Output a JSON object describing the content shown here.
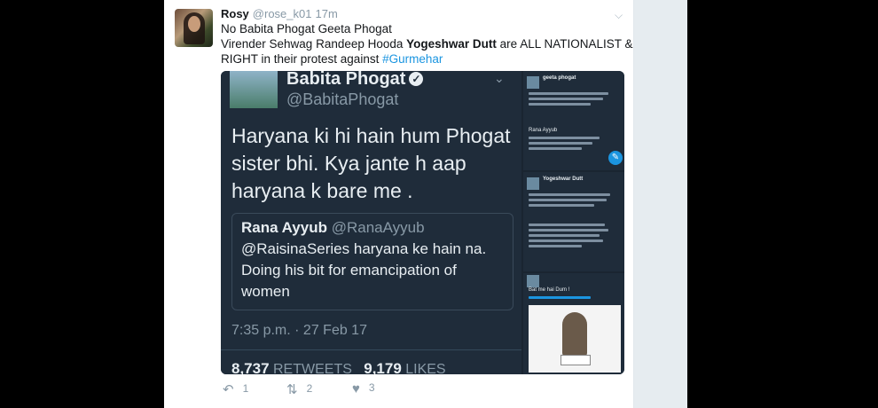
{
  "tweet": {
    "name": "Rosy",
    "handle": "@rose_k01",
    "time": "17m",
    "line1": "No Babita Phogat Geeta Phogat",
    "line2_pre": "Virender Sehwag Randeep Hooda ",
    "line2_bold": "Yogeshwar Dutt",
    "line2_post": " are  ALL NATIONALIST &",
    "line3_pre": "RIGHT in their protest against ",
    "hashtag": "#Gurmehar"
  },
  "embedded": {
    "name": "Babita Phogat",
    "check": "✓",
    "handle": "@BabitaPhogat",
    "text": "Haryana ki hi hain hum Phogat sister bhi. Kya jante h aap haryana k bare me .",
    "quote_name": "Rana Ayyub",
    "quote_handle": "@RanaAyyub",
    "quote_text": "@RaisinaSeries haryana ke hain na. Doing his bit for emancipation of women",
    "timestamp": "7:35 p.m. · 27 Feb 17",
    "retweets_count": "8,737",
    "retweets_label": "RETWEETS",
    "likes_count": "9,179",
    "likes_label": "LIKES"
  },
  "side": {
    "s1_name": "geeta phogat",
    "s1_quote": "Rana Ayyub",
    "s2_name": "Yogeshwar Dutt",
    "s3_text": "Bat me hai Dum !"
  },
  "actions": {
    "reply_count": "1",
    "retweet_count": "2",
    "like_count": "3"
  },
  "icons": {
    "reply": "reply-icon",
    "retweet": "retweet-icon",
    "like": "heart-icon",
    "more": "chevron-down-icon"
  }
}
